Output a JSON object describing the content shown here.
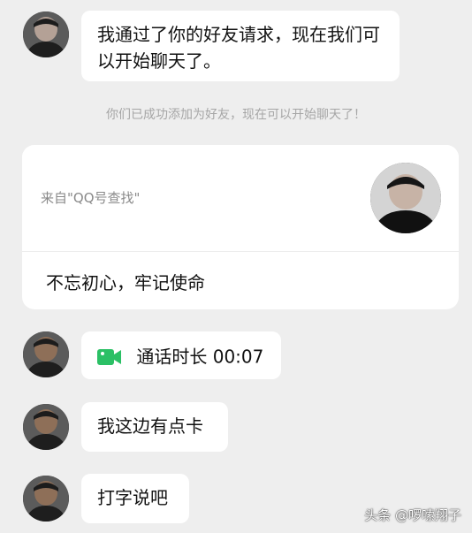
{
  "messages": {
    "accept_text": "我通过了你的好友请求，现在我们可以开始聊天了。",
    "system_notice": "你们已成功添加为好友，现在可以开始聊天了！",
    "card_source": "来自\"QQ号查找\"",
    "card_message": "不忘初心，牢记使命",
    "call_text": "通话时长 00:07",
    "lag_text": "我这边有点卡",
    "type_text": "打字说吧"
  },
  "icons": {
    "call": "video-call-icon"
  },
  "colors": {
    "background": "#eeeeee",
    "bubble": "#ffffff",
    "call_icon": "#2bc065",
    "system_text": "#a6a6a6"
  },
  "watermark": "头条 @啰嗦翔子"
}
